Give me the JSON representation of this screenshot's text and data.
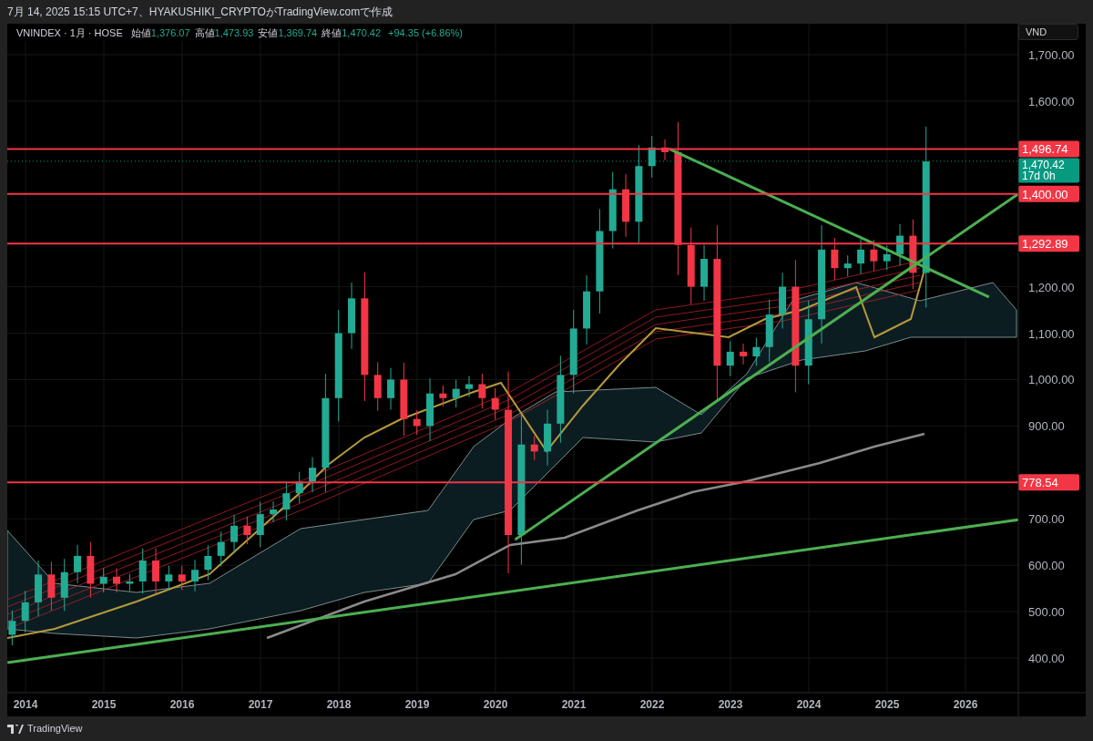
{
  "caption": "7月 14, 2025 15:15 UTC+7、HYAKUSHIKI_CRYPTOがTradingView.comで作成",
  "legend": {
    "symbol": "VNINDEX · 1月 · HOSE",
    "fields": [
      {
        "label": "始値",
        "value": "1,376.07"
      },
      {
        "label": "高値",
        "value": "1,473.93"
      },
      {
        "label": "安値",
        "value": "1,369.74"
      },
      {
        "label": "終値",
        "value": "1,470.42"
      }
    ],
    "change": "+94.35 (+6.86%)"
  },
  "currency_button": "VND",
  "price_axis": [
    "1,700.00",
    "1,600.00",
    "1,200.00",
    "1,100.00",
    "1,000.00",
    "900.00",
    "700.00",
    "600.00",
    "500.00",
    "400.00"
  ],
  "time_axis": [
    "2014",
    "2015",
    "2016",
    "2017",
    "2018",
    "2019",
    "2020",
    "2021",
    "2022",
    "2023",
    "2024",
    "2025",
    "2026"
  ],
  "price_levels": [
    {
      "label": "1,496.74"
    },
    {
      "label": "1,400.00"
    },
    {
      "label": "1,292.89"
    },
    {
      "label": "778.54"
    }
  ],
  "last_price": {
    "label": "1,470.42",
    "countdown": "17d 0h"
  },
  "footer": {
    "brand": "TradingView"
  }
}
